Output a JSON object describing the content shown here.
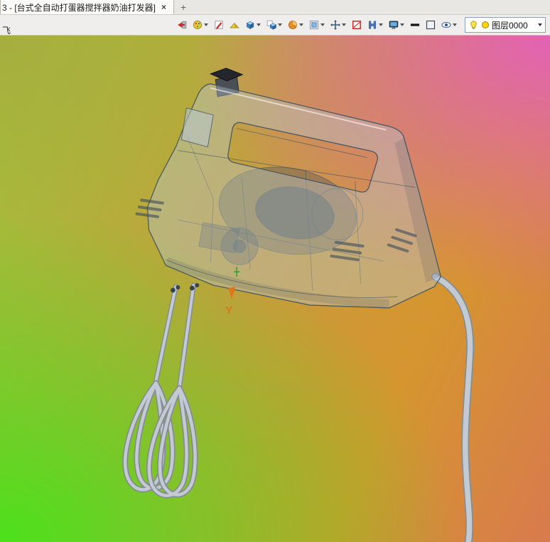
{
  "window": {
    "tab_title": "3 - [台式全自动打蛋器搅拌器奶油打发器]",
    "tab_close_glyph": "×",
    "new_tab_glyph": "+"
  },
  "toolbar": {
    "corner_glyph": "飞",
    "icons": [
      "import-icon",
      "palette-icon",
      "pen-icon",
      "wedge-icon",
      "cube-icon",
      "boolean-cube-icon",
      "sphere-icon",
      "plane-icon",
      "move-icon",
      "window-icon",
      "grid-icon",
      "monitor-icon",
      "line-width-icon",
      "background-swatch-icon",
      "eye-icon"
    ],
    "layer_selector": {
      "label": "图层0000"
    }
  },
  "viewport": {
    "axis_label": "Y",
    "background_corners": {
      "top_left": "#a9a93f",
      "top_right": "#e45cc4",
      "bottom_left": "#46e41a",
      "bottom_right": "#d6952f"
    }
  },
  "colors": {
    "model_body": "#b8c7d4",
    "model_outline": "#46555f",
    "model_dark": "#3c4b5a",
    "cord": "#c3cad1",
    "cord_edge": "#848c94",
    "axis_y": "#e0761a",
    "layer_dot": "#ffd400",
    "toolbar_bg": "#f0eeec",
    "tab_bg": "#e9e7e4"
  }
}
